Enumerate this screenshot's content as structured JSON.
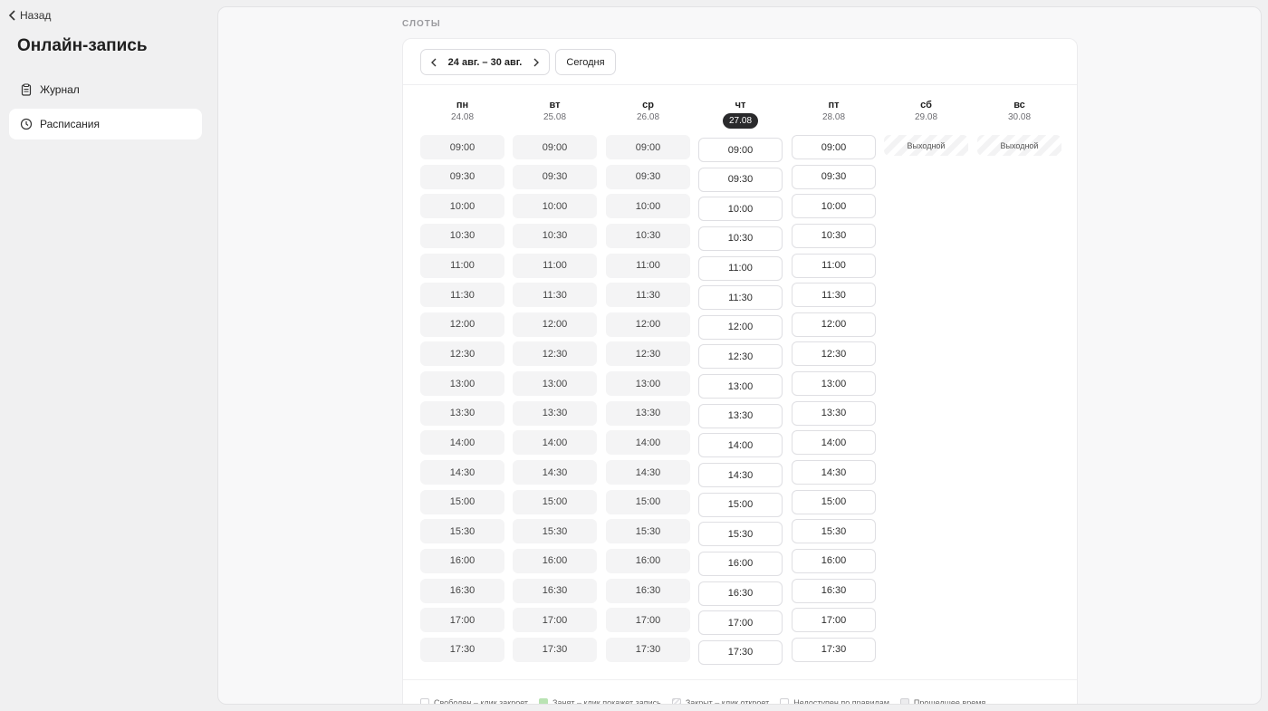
{
  "sidebar": {
    "back_label": "Назад",
    "title": "Онлайн-запись",
    "items": [
      {
        "label": "Журнал",
        "icon": "clipboard-icon",
        "active": false
      },
      {
        "label": "Расписания",
        "icon": "clock-icon",
        "active": true
      }
    ]
  },
  "main": {
    "section_label": "СЛОТЫ",
    "week_range": "24 авг. – 30 авг.",
    "today_label": "Сегодня"
  },
  "days": [
    {
      "name": "пн",
      "date": "24.08",
      "state": "past"
    },
    {
      "name": "вт",
      "date": "25.08",
      "state": "past"
    },
    {
      "name": "ср",
      "date": "26.08",
      "state": "past"
    },
    {
      "name": "чт",
      "date": "27.08",
      "state": "free",
      "today": true
    },
    {
      "name": "пт",
      "date": "28.08",
      "state": "free"
    },
    {
      "name": "сб",
      "date": "29.08",
      "state": "dayoff",
      "dayoff_label": "Выходной"
    },
    {
      "name": "вс",
      "date": "30.08",
      "state": "dayoff",
      "dayoff_label": "Выходной"
    }
  ],
  "times": [
    "09:00",
    "09:30",
    "10:00",
    "10:30",
    "11:00",
    "11:30",
    "12:00",
    "12:30",
    "13:00",
    "13:30",
    "14:00",
    "14:30",
    "15:00",
    "15:30",
    "16:00",
    "16:30",
    "17:00",
    "17:30"
  ],
  "legend": [
    {
      "label": "Свободен – клик закроет",
      "swatch": "free"
    },
    {
      "label": "Занят – клик покажет запись",
      "swatch": "booked"
    },
    {
      "label": "Закрыт – клик откроет",
      "swatch": "closed"
    },
    {
      "label": "Недоступен по правилам",
      "swatch": "unavail"
    },
    {
      "label": "Прошедшее время",
      "swatch": "past"
    }
  ]
}
